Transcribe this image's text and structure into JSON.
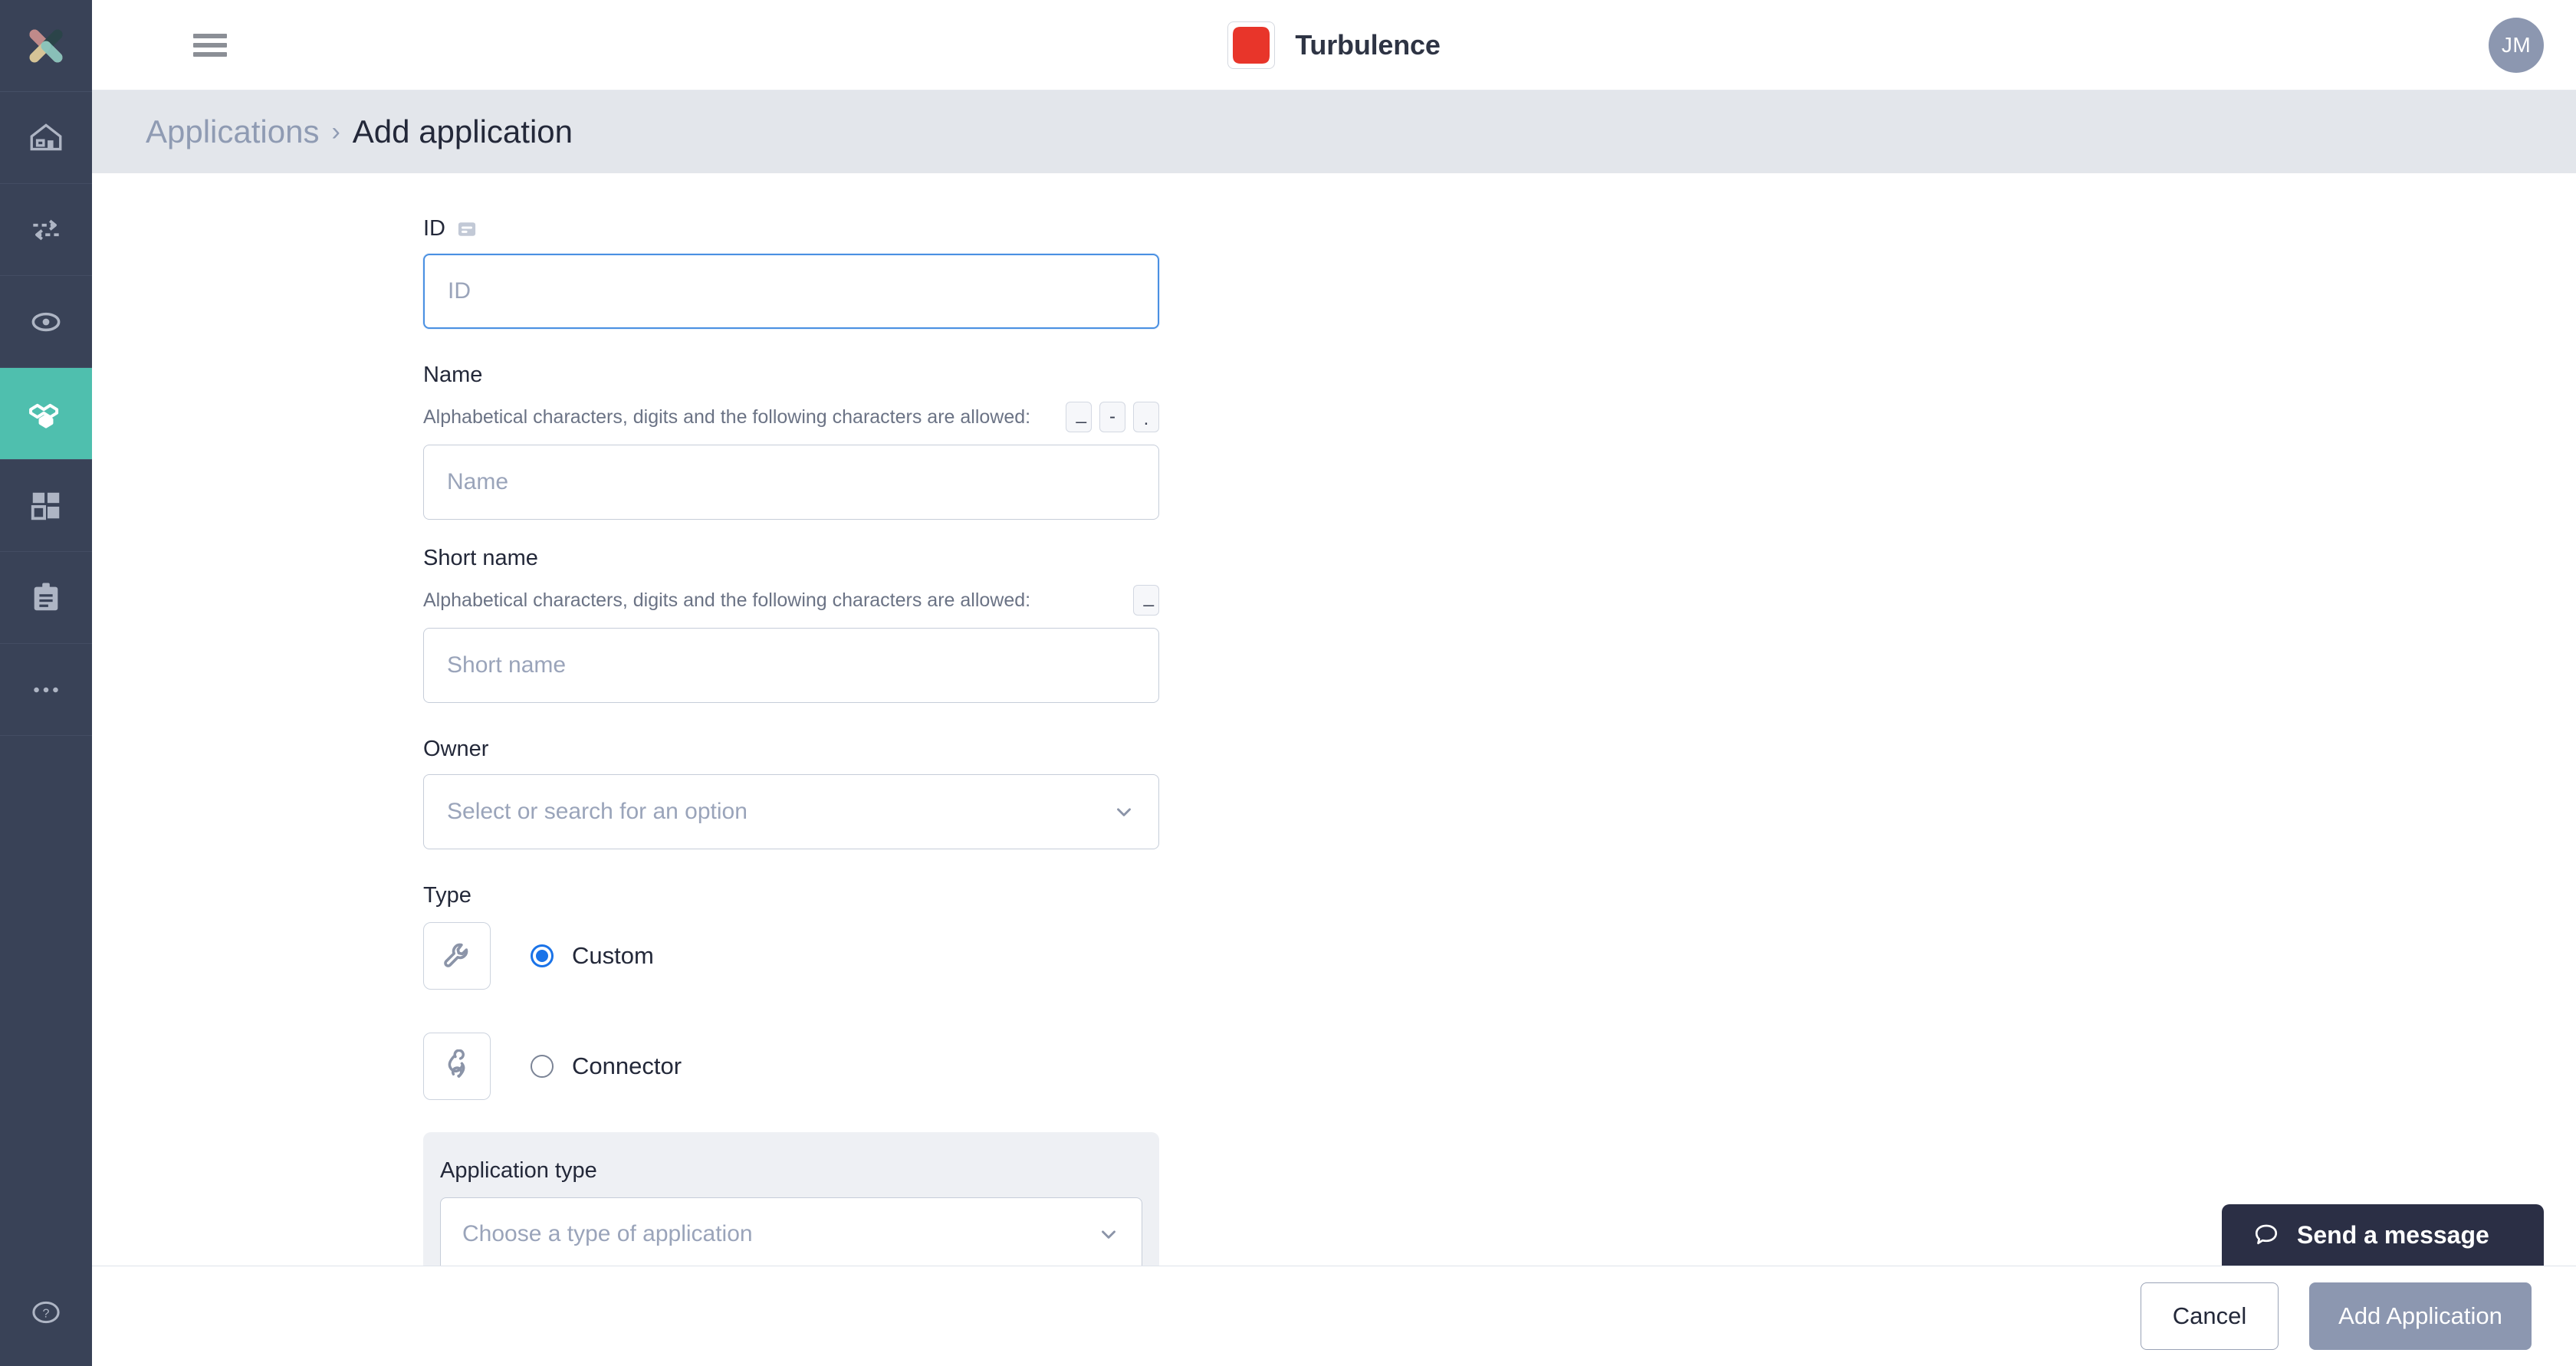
{
  "brand": {
    "name": "Turbulence",
    "logo_icon": "red-cross-logo-icon",
    "logo_color": "#e8352a"
  },
  "topbar": {
    "menu_icon": "hamburger-menu-icon",
    "avatar_initials": "JM"
  },
  "sidebar": {
    "logo_icon": "x-mark-brand-logo-icon",
    "accent_color": "#4fbfae",
    "background_color": "#394257",
    "items": [
      {
        "icon": "home-icon",
        "name": "home",
        "active": false
      },
      {
        "icon": "data-transfer-arrows-icon",
        "name": "transfers",
        "active": false
      },
      {
        "icon": "eye-monitoring-icon",
        "name": "monitoring",
        "active": false
      },
      {
        "icon": "applications-hexagon-icon",
        "name": "applications",
        "active": true
      },
      {
        "icon": "grid-squares-icon",
        "name": "dashboards",
        "active": false
      },
      {
        "icon": "clipboard-icon",
        "name": "reports",
        "active": false
      },
      {
        "icon": "ellipsis-more-icon",
        "name": "more",
        "active": false
      }
    ],
    "help_icon": "question-mark-help-icon"
  },
  "breadcrumb": {
    "parent": "Applications",
    "separator": "›",
    "current": "Add application"
  },
  "form": {
    "id": {
      "label": "ID",
      "badge_icon": "id-card-icon",
      "placeholder": "ID",
      "value": "",
      "focused": true
    },
    "name": {
      "label": "Name",
      "hint": "Alphabetical characters, digits and the following characters are allowed:",
      "allowed_chars": [
        "_",
        "-",
        "."
      ],
      "placeholder": "Name",
      "value": ""
    },
    "short_name": {
      "label": "Short name",
      "hint": "Alphabetical characters, digits and the following characters are allowed:",
      "allowed_chars": [
        "_"
      ],
      "placeholder": "Short name",
      "value": ""
    },
    "owner": {
      "label": "Owner",
      "placeholder": "Select or search for an option",
      "value": "",
      "chevron_icon": "chevron-down-icon"
    },
    "type": {
      "label": "Type",
      "options": [
        {
          "label": "Custom",
          "icon": "wrench-icon",
          "selected": true
        },
        {
          "label": "Connector",
          "icon": "link-chain-icon",
          "selected": false
        }
      ]
    },
    "application_type": {
      "label": "Application type",
      "placeholder": "Choose a type of application",
      "value": "",
      "chevron_icon": "chevron-down-icon"
    }
  },
  "footer": {
    "cancel_label": "Cancel",
    "submit_label": "Add Application"
  },
  "chat": {
    "label": "Send a message",
    "icon": "speech-bubble-icon"
  }
}
